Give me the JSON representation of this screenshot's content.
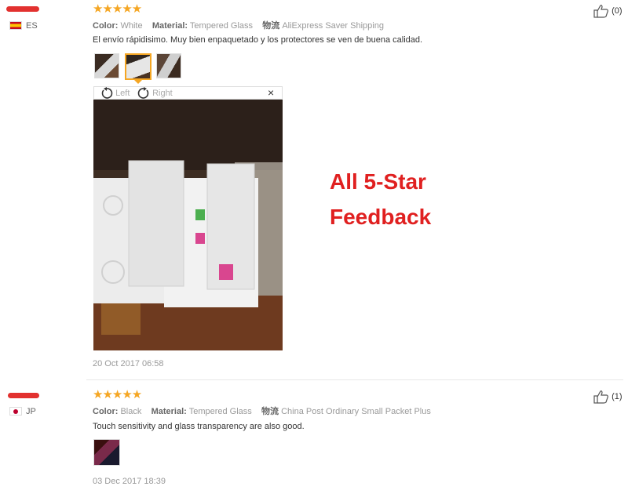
{
  "reviews": [
    {
      "country": "ES",
      "stars": "★★★★★",
      "color_label": "Color:",
      "color_value": "White",
      "material_label": "Material:",
      "material_value": "Tempered Glass",
      "shipping_label": "物流",
      "shipping_value": "AliExpress Saver Shipping",
      "text": "El envío rápidisimo. Muy bien enpaquetado y los protectores se ven de buena calidad.",
      "date": "20 Oct 2017 06:58",
      "helpful_count": "(0)"
    },
    {
      "country": "JP",
      "stars": "★★★★★",
      "color_label": "Color:",
      "color_value": "Black",
      "material_label": "Material:",
      "material_value": "Tempered Glass",
      "shipping_label": "物流",
      "shipping_value": "China Post Ordinary Small Packet Plus",
      "text": "Touch sensitivity and glass transparency are also good.",
      "date": "03 Dec 2017 18:39",
      "helpful_count": "(1)"
    }
  ],
  "viewer": {
    "left_label": "Left",
    "right_label": "Right",
    "close": "×"
  },
  "promo": {
    "line1": "All 5-Star",
    "line2": "Feedback"
  },
  "colors": {
    "star": "#f5a623",
    "promo": "#e02020",
    "redaction": "#e2312f"
  }
}
